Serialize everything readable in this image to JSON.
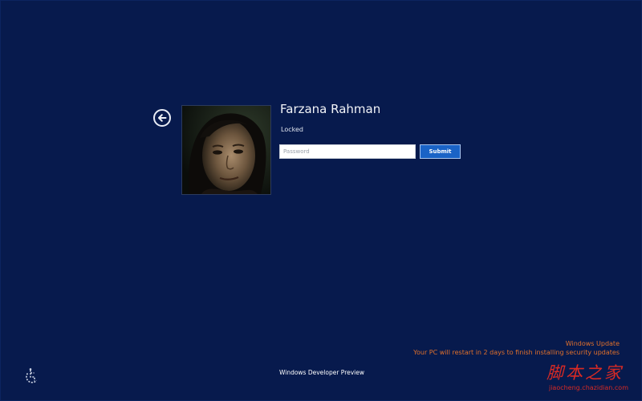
{
  "login": {
    "user_name": "Farzana Rahman",
    "status": "Locked",
    "password_placeholder": "Password",
    "submit_label": "Submit",
    "back_icon": "back-arrow-icon"
  },
  "notification": {
    "title": "Windows Update",
    "message": "Your PC will restart in 2 days to finish installing security updates"
  },
  "footer": {
    "text": "Windows Developer Preview",
    "ease_of_access_icon": "ease-of-access-icon"
  },
  "watermark": {
    "main": "脚本之家",
    "url": "jiaocheng.chazidian.com"
  },
  "colors": {
    "background": "#071a4d",
    "accent_button": "#1a63c6",
    "notification_text": "#e0702b",
    "watermark": "#d92a24"
  }
}
